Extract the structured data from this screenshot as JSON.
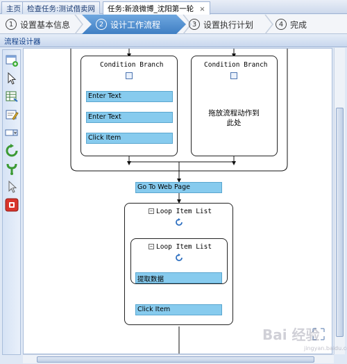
{
  "tabs": [
    {
      "label": "主页"
    },
    {
      "label": "检查任务:测试借卖网"
    },
    {
      "label": "任务:新浪微博_沈阳第一轮"
    }
  ],
  "tab_close_glyph": "×",
  "steps": [
    {
      "num": "1",
      "label": "设置基本信息"
    },
    {
      "num": "2",
      "label": "设计工作流程"
    },
    {
      "num": "3",
      "label": "设置执行计划"
    },
    {
      "num": "4",
      "label": "完成"
    }
  ],
  "active_step": 2,
  "panel_title": "流程设计器",
  "toolbar_icons": [
    "web-page-icon",
    "click-icon",
    "extract-data-icon",
    "enter-text-icon",
    "select-option-icon",
    "loop-icon",
    "condition-icon",
    "mouse-hover-icon",
    "stop-icon"
  ],
  "flow": {
    "branch1": {
      "title": "Condition Branch",
      "actions": [
        "Enter Text",
        "Enter Text",
        "Click Item"
      ]
    },
    "branch2": {
      "title": "Condition Branch",
      "drop_hint_line1": "拖放流程动作到",
      "drop_hint_line2": "此处"
    },
    "goto_label": "Go To Web Page",
    "outer_loop": {
      "title": "Loop Item List",
      "inner_loop": {
        "title": "Loop Item List",
        "action": "提取数据"
      },
      "action": "Click Item"
    },
    "collapse_glyph": "−"
  },
  "colors": {
    "action_fill": "#87cbee",
    "active_step": "#3f7fc4",
    "stop_icon": "#d9342b"
  },
  "watermark": "Bai 经验",
  "watermark_sub": "jingyan.baidu.com"
}
